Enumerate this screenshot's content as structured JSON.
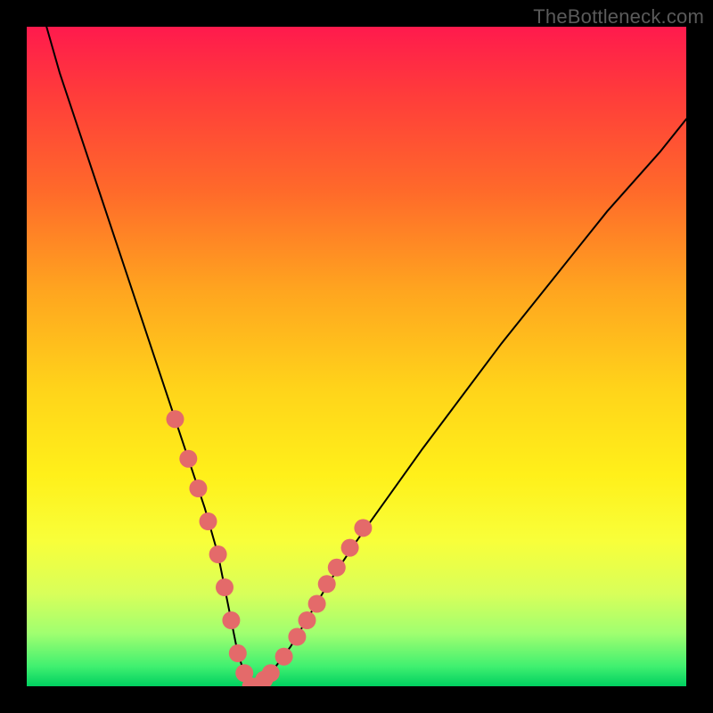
{
  "watermark": "TheBottleneck.com",
  "colors": {
    "gradient_top": "#ff1a4d",
    "gradient_bottom": "#00d060",
    "curve": "#000000",
    "marker": "#e46a6a",
    "frame": "#000000"
  },
  "chart_data": {
    "type": "line",
    "title": "",
    "xlabel": "",
    "ylabel": "",
    "xlim": [
      0,
      100
    ],
    "ylim": [
      0,
      100
    ],
    "grid": false,
    "legend": false,
    "series": [
      {
        "name": "bottleneck-curve",
        "x": [
          3,
          5,
          8,
          11,
          14,
          17,
          20,
          23,
          25,
          27,
          29,
          30,
          31,
          32,
          33,
          34,
          35,
          37,
          40,
          43,
          46,
          50,
          55,
          60,
          66,
          72,
          80,
          88,
          96,
          100
        ],
        "values": [
          100,
          93,
          84,
          75,
          66,
          57,
          48,
          39,
          33,
          27,
          20,
          15,
          10,
          5,
          2,
          0,
          0,
          2,
          6,
          11,
          16,
          22,
          29,
          36,
          44,
          52,
          62,
          72,
          81,
          86
        ]
      }
    ],
    "markers": {
      "name": "highlight-dots",
      "x": [
        22.5,
        24.5,
        26.0,
        27.5,
        29.0,
        30.0,
        31.0,
        32.0,
        33.0,
        34.0,
        35.0,
        36.0,
        37.0,
        39.0,
        41.0,
        42.5,
        44.0,
        45.5,
        47.0,
        49.0,
        51.0
      ],
      "values": [
        40.5,
        34.5,
        30.0,
        25.0,
        20.0,
        15.0,
        10.0,
        5.0,
        2.0,
        0.0,
        0.0,
        1.0,
        2.0,
        4.5,
        7.5,
        10.0,
        12.5,
        15.5,
        18.0,
        21.0,
        24.0
      ]
    }
  }
}
